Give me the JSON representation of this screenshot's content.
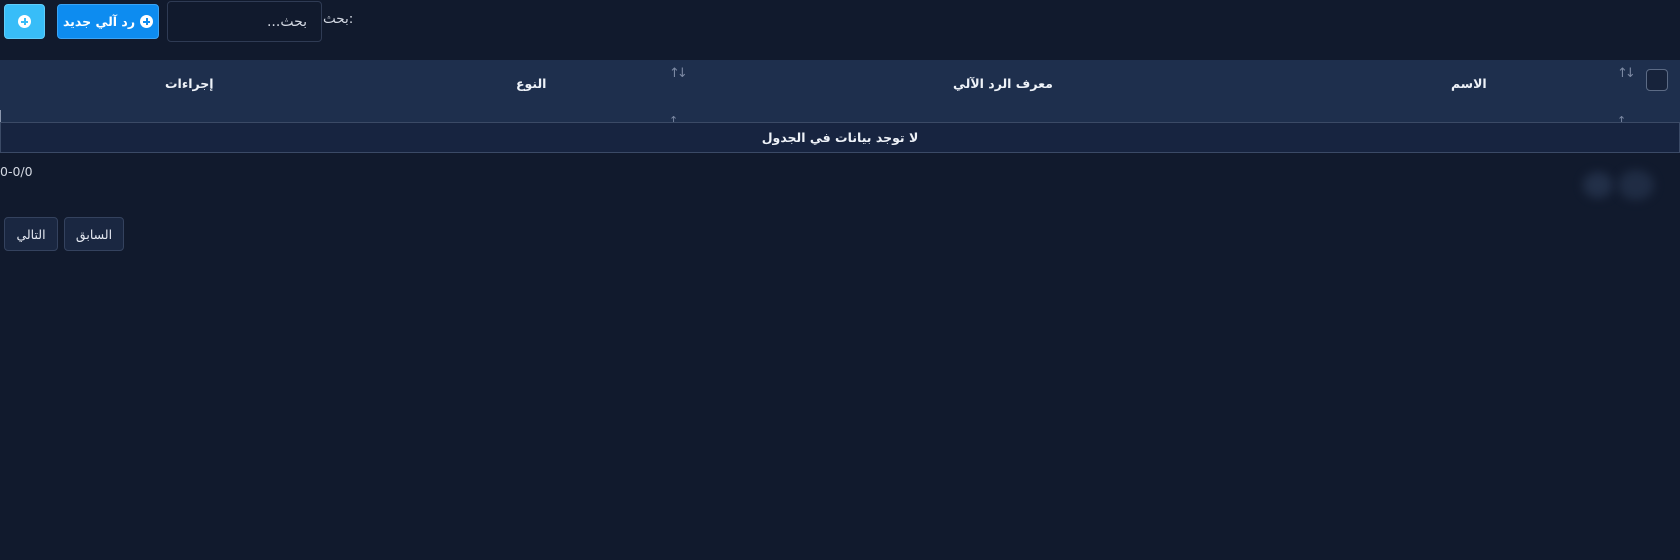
{
  "toolbar": {
    "new_button_label": "رد آلي جديد",
    "search_label": "بحث:",
    "search_placeholder": "بحث..."
  },
  "table": {
    "columns": [
      "الاسم",
      "معرف الرد الآلي",
      "النوع",
      "إجراءات"
    ],
    "empty_message": "لا توجد بيانات في الجدول"
  },
  "pagination": {
    "count": "0-0/0",
    "prev_label": "السابق",
    "next_label": "التالي"
  },
  "icons": {
    "add": "plus-circle",
    "sort": "sort-arrows",
    "sort_up": "arrow-up"
  },
  "colors": {
    "background": "#111a2d",
    "header": "#1e2f4d",
    "primary": "#0d8cf0",
    "accent": "#38bdf8"
  }
}
